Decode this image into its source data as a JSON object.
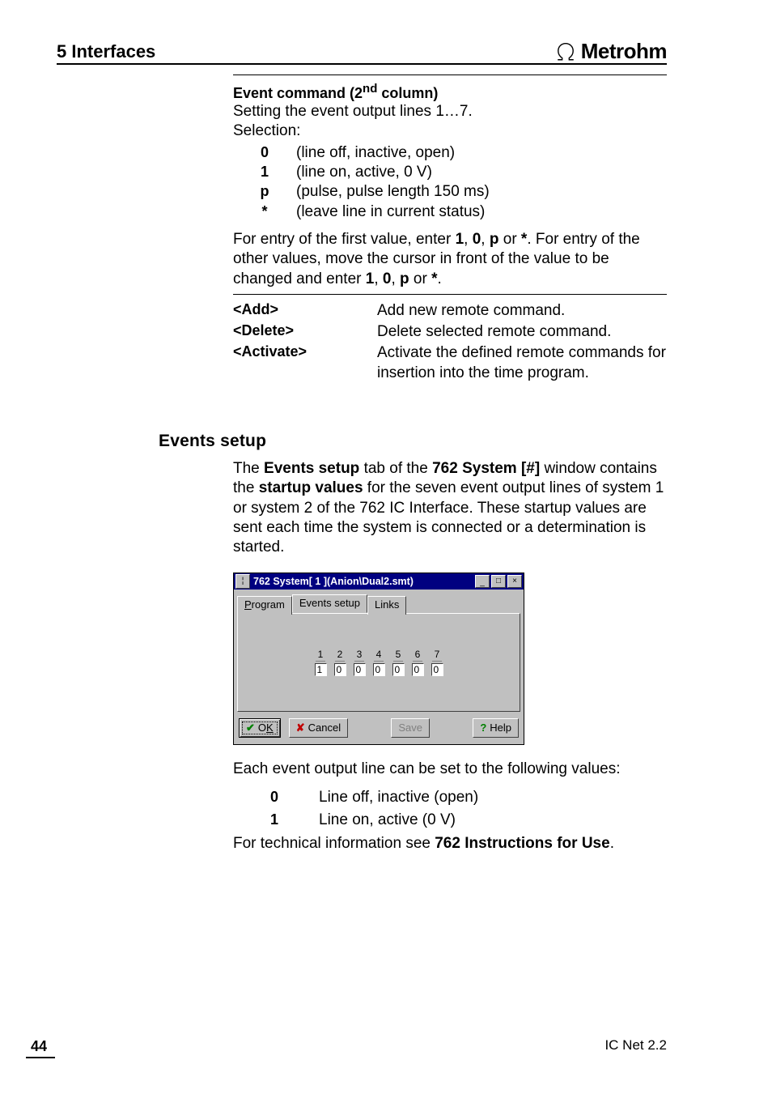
{
  "header": {
    "section": "5  Interfaces",
    "brand": "Metrohm"
  },
  "event_command": {
    "title_prefix": "Event command (2",
    "title_super": "nd",
    "title_suffix": " column)",
    "intro1": "Setting the event output lines 1…7.",
    "intro2": "Selection:",
    "options": [
      {
        "key": "0",
        "desc": "(line off, inactive, open)"
      },
      {
        "key": "1",
        "desc": "(line on, active, 0 V)"
      },
      {
        "key": "p",
        "desc": "(pulse, pulse length 150 ms)"
      },
      {
        "key": "*",
        "desc": "(leave line in current status)"
      }
    ],
    "entry_p1a": "For entry of the first value, enter ",
    "entry_bold1": "1",
    "entry_sep": ", ",
    "entry_bold2": "0",
    "entry_bold3": "p",
    "entry_or": " or ",
    "entry_bold4": "*",
    "entry_dot": ".",
    "entry_p1b": "For entry of the other values, move the cursor in front of the value to be changed and enter ",
    "entry2_bold1": "1",
    "entry2_bold2": "0",
    "entry2_bold3": "p",
    "entry2_bold4": "*"
  },
  "commands": [
    {
      "term": "<Add>",
      "desc": "Add new remote command."
    },
    {
      "term": "<Delete>",
      "desc": "Delete selected remote command."
    },
    {
      "term": "<Activate>",
      "desc": "Activate the defined remote commands for insertion into the time program."
    }
  ],
  "events_setup": {
    "heading": "Events setup",
    "para_pre": "The ",
    "para_b1": "Events setup",
    "para_mid1": " tab of the ",
    "para_b2": "762 System [#]",
    "para_mid2": " window contains the ",
    "para_b3": "startup values",
    "para_post": " for the seven event output lines of system 1 or system 2 of the 762 IC Interface. These startup values are sent each time the system is connected or a determination is started."
  },
  "window": {
    "title": "762 System[ 1 ](Anion\\Dual2.smt)",
    "tabs": {
      "program": "Program",
      "events": "Events setup",
      "links": "Links"
    },
    "lines": [
      {
        "num": "1",
        "val": "1"
      },
      {
        "num": "2",
        "val": "0"
      },
      {
        "num": "3",
        "val": "0"
      },
      {
        "num": "4",
        "val": "0"
      },
      {
        "num": "5",
        "val": "0"
      },
      {
        "num": "6",
        "val": "0"
      },
      {
        "num": "7",
        "val": "0"
      }
    ],
    "buttons": {
      "ok_u": "K",
      "ok_pre": "O",
      "cancel": "Cancel",
      "save": "Save",
      "help": "Help"
    }
  },
  "after_window": {
    "para1": "Each event output line can be set to the following values:",
    "values": [
      {
        "key": "0",
        "desc": "Line off, inactive (open)"
      },
      {
        "key": "1",
        "desc": "Line on, active (0 V)"
      }
    ],
    "para2_pre": "For technical information see ",
    "para2_bold": "762 Instructions for Use",
    "para2_post": "."
  },
  "footer": {
    "page": "44",
    "product": "IC Net 2.2"
  }
}
